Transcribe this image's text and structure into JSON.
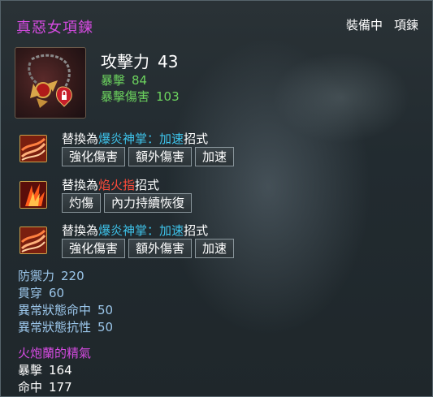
{
  "item": {
    "name": "真惡女項鍊",
    "equipped_label": "裝備中",
    "slot_label": "項鍊",
    "icon": "necklace-icon"
  },
  "main_stat": {
    "label": "攻擊力",
    "value": "43"
  },
  "sub_stats": [
    {
      "label": "暴擊",
      "value": "84"
    },
    {
      "label": "暴擊傷害",
      "value": "103"
    }
  ],
  "skills": [
    {
      "icon": "flame-palm-skill-icon",
      "prefix": "替換為",
      "name_a": "爆炎神掌",
      "sep": "：",
      "name_b": "加速",
      "suffix": "招式",
      "tags": [
        "強化傷害",
        "額外傷害",
        "加速"
      ]
    },
    {
      "icon": "flame-finger-skill-icon",
      "prefix": "替換為",
      "name_a": "焰火指",
      "suffix": "招式",
      "tags": [
        "灼傷",
        "內力持續恢復"
      ]
    },
    {
      "icon": "flame-palm-skill-icon",
      "prefix": "替換為",
      "name_a": "爆炎神掌",
      "sep": "：",
      "name_b": "加速",
      "suffix": "招式",
      "tags": [
        "強化傷害",
        "額外傷害",
        "加速"
      ]
    }
  ],
  "defense_stats": [
    {
      "label": "防禦力",
      "value": "220"
    },
    {
      "label": "貫穿",
      "value": "60"
    },
    {
      "label": "異常狀態命中",
      "value": "50"
    },
    {
      "label": "異常狀態抗性",
      "value": "50"
    }
  ],
  "essence": {
    "title": "火炮蘭的精氣",
    "stats": [
      {
        "label": "暴擊",
        "value": "164"
      },
      {
        "label": "命中",
        "value": "177"
      }
    ]
  },
  "colors": {
    "title": "#d44be0",
    "green": "#6cd35e",
    "cyan": "#3ec3ea",
    "red": "#ff4b3a",
    "blue": "#9bc6ea"
  }
}
